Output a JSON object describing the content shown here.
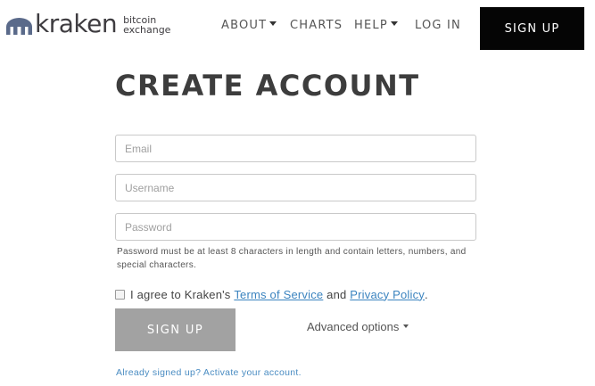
{
  "brand": {
    "name": "kraken",
    "tagline_line1": "bitcoin",
    "tagline_line2": "exchange",
    "logo_icon": "kraken-logo-icon",
    "mark_color": "#5a6a8a"
  },
  "nav": {
    "about": "ABOUT",
    "charts": "CHARTS",
    "help": "HELP",
    "login": "LOG IN",
    "signup": "SIGN UP"
  },
  "form": {
    "title": "CREATE ACCOUNT",
    "email_placeholder": "Email",
    "username_placeholder": "Username",
    "password_placeholder": "Password",
    "password_hint": "Password must be at least 8 characters in length and contain letters, numbers, and special characters.",
    "agree_prefix": "I agree to Kraken's",
    "terms_link": "Terms of Service",
    "agree_and": "and",
    "privacy_link": "Privacy Policy",
    "agree_suffix": ".",
    "signup_button": "SIGN UP",
    "advanced_options": "Advanced options",
    "already_signed_up": "Already signed up? Activate your account."
  },
  "colors": {
    "signup_top_bg": "#050505",
    "signup_main_bg": "#a2a2a2",
    "link": "#3a83bf"
  }
}
